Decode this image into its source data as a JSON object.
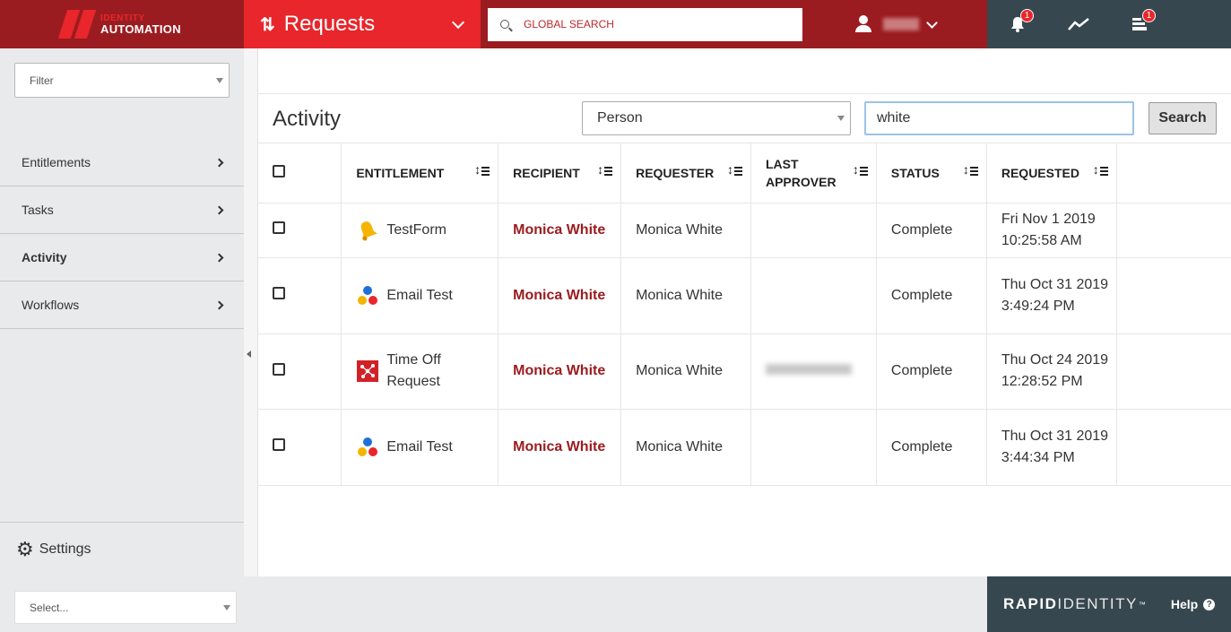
{
  "header": {
    "logo_line1": "IDENTITY",
    "logo_line2": "AUTOMATION",
    "module_label": "Requests",
    "global_search_placeholder": "GLOBAL SEARCH",
    "notifications_badge": "1",
    "queue_badge": "1"
  },
  "sidebar": {
    "filter_placeholder": "Filter",
    "items": [
      {
        "label": "Entitlements",
        "active": false
      },
      {
        "label": "Tasks",
        "active": false
      },
      {
        "label": "Activity",
        "active": true
      },
      {
        "label": "Workflows",
        "active": false
      }
    ],
    "settings_label": "Settings"
  },
  "main": {
    "title": "Activity",
    "search_type": "Person",
    "search_value": "white",
    "search_button": "Search",
    "columns": [
      "ENTITLEMENT",
      "RECIPIENT",
      "REQUESTER",
      "LAST APPROVER",
      "STATUS",
      "REQUESTED"
    ],
    "rows": [
      {
        "entitlement": "TestForm",
        "icon": "bell-icon",
        "recipient": "Monica White",
        "requester": "Monica White",
        "last_approver": "",
        "status": "Complete",
        "requested": "Fri Nov 1 2019 10:25:58 AM"
      },
      {
        "entitlement": "Email Test",
        "icon": "molecule-icon",
        "recipient": "Monica White",
        "requester": "Monica White",
        "last_approver": "",
        "status": "Complete",
        "requested": "Thu Oct 31 2019 3:49:24 PM"
      },
      {
        "entitlement": "Time Off Request",
        "icon": "network-icon",
        "recipient": "Monica White",
        "requester": "Monica White",
        "last_approver": "",
        "status": "Complete",
        "requested": "Thu Oct 24 2019 12:28:52 PM"
      },
      {
        "entitlement": "Email Test",
        "icon": "molecule-icon",
        "recipient": "Monica White",
        "requester": "Monica White",
        "last_approver": "",
        "status": "Complete",
        "requested": "Thu Oct 31 2019 3:44:34 PM"
      }
    ]
  },
  "footer": {
    "select_placeholder": "Select...",
    "brand_bold": "RAPID",
    "brand_light": "IDENTITY",
    "brand_tm": "™",
    "help_label": "Help"
  },
  "colors": {
    "brand_dark_red": "#9b1c20",
    "brand_red": "#e8262b",
    "slate": "#37474f"
  }
}
